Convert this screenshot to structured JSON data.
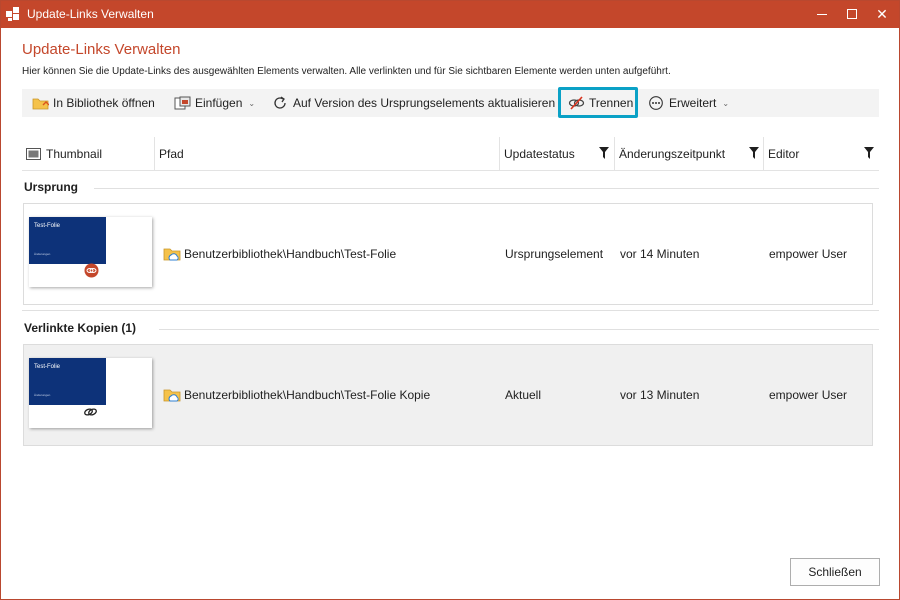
{
  "window": {
    "title": "Update-Links Verwalten",
    "accent_color": "#c4472b",
    "controls": {
      "minimize_icon": "minimize-icon",
      "maximize_icon": "maximize-icon",
      "close_icon": "close-icon",
      "close_glyph": "✕"
    }
  },
  "header": {
    "title": "Update-Links Verwalten",
    "description": "Hier können Sie die Update-Links des ausgewählten Elements verwalten. Alle verlinkten und für Sie sichtbaren Elemente werden unten aufgeführt."
  },
  "toolbar": {
    "items": [
      {
        "label": "In Bibliothek öffnen",
        "icon": "folder-open-icon"
      },
      {
        "label": "Einfügen",
        "icon": "insert-icon",
        "has_dropdown": true
      },
      {
        "label": "Auf Version des Ursprungselements aktualisieren",
        "icon": "refresh-icon"
      },
      {
        "label": "Trennen",
        "icon": "unlink-icon",
        "highlighted": true,
        "highlight_color": "#0aa1c6"
      },
      {
        "label": "Erweitert",
        "icon": "more-icon",
        "has_dropdown": true
      }
    ],
    "caret": "⌄"
  },
  "columns": [
    {
      "label": "Thumbnail",
      "icon": "image-icon"
    },
    {
      "label": "Pfad"
    },
    {
      "label": "Updatestatus",
      "filter": true
    },
    {
      "label": "Änderungszeitpunkt",
      "filter": true
    },
    {
      "label": "Editor",
      "filter": true
    }
  ],
  "groups": [
    {
      "label": "Ursprung",
      "rows": [
        {
          "thumbnail_title": "Test-Folie",
          "thumbnail_subtitle": "Änderungen",
          "thumbnail_badge": "source-badge-icon",
          "path": "Benutzerbibliothek\\Handbuch\\Test-Folie",
          "status": "Ursprungselement",
          "changed": "vor 14 Minuten",
          "editor": "empower User",
          "selected": false
        }
      ]
    },
    {
      "label": "Verlinkte Kopien (1)",
      "rows": [
        {
          "thumbnail_title": "Test-Folie",
          "thumbnail_subtitle": "Änderungen",
          "thumbnail_badge": "link-icon",
          "path": "Benutzerbibliothek\\Handbuch\\Test-Folie Kopie",
          "status": "Aktuell",
          "changed": "vor 13 Minuten",
          "editor": "empower User",
          "selected": true
        }
      ]
    }
  ],
  "footer": {
    "close_label": "Schließen"
  }
}
